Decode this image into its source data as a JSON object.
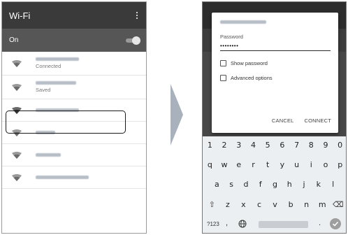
{
  "left_phone": {
    "title": "Wi-Fi",
    "toggle_label": "On",
    "toggle_state": "on",
    "networks": [
      {
        "status": "Connected"
      },
      {
        "status": "Saved"
      },
      {
        "status": ""
      },
      {
        "status": ""
      },
      {
        "status": ""
      },
      {
        "status": ""
      }
    ]
  },
  "dialog": {
    "password_label": "Password",
    "password_value": "••••••••",
    "show_password_label": "Show password",
    "advanced_options_label": "Advanced options",
    "cancel_label": "CANCEL",
    "connect_label": "CONNECT"
  },
  "keyboard": {
    "row1": [
      "1",
      "2",
      "3",
      "4",
      "5",
      "6",
      "7",
      "8",
      "9",
      "0"
    ],
    "row2": [
      "q",
      "w",
      "e",
      "r",
      "t",
      "y",
      "u",
      "i",
      "o",
      "p"
    ],
    "row3": [
      "a",
      "s",
      "d",
      "f",
      "g",
      "h",
      "j",
      "k",
      "l"
    ],
    "row4": [
      "⇧",
      "z",
      "x",
      "c",
      "v",
      "b",
      "n",
      "m",
      "⌫"
    ],
    "symbols_key": "?123",
    "comma_key": ",",
    "period_key": "."
  },
  "colors": {
    "header_dark": "#3a3a3a",
    "toggle_row": "#565656",
    "highlight_border": "#1a1a1a",
    "arrow": "#a9b2bc"
  }
}
